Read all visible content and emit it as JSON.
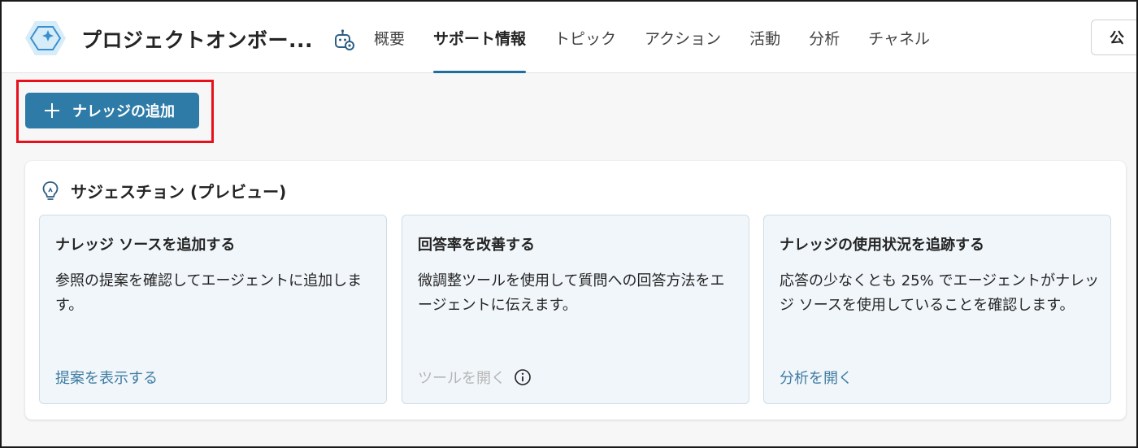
{
  "header": {
    "app_title": "プロジェクトオンボー...",
    "tabs": [
      {
        "label": "概要",
        "active": false
      },
      {
        "label": "サポート情報",
        "active": true
      },
      {
        "label": "トピック",
        "active": false
      },
      {
        "label": "アクション",
        "active": false
      },
      {
        "label": "活動",
        "active": false
      },
      {
        "label": "分析",
        "active": false
      },
      {
        "label": "チャネル",
        "active": false
      }
    ],
    "publish_label": "公"
  },
  "toolbar": {
    "add_knowledge_label": "ナレッジの追加"
  },
  "suggestions": {
    "title": "サジェスチョン (プレビュー)",
    "cards": [
      {
        "title": "ナレッジ ソースを追加する",
        "description": "参照の提案を確認してエージェントに追加します。",
        "link": "提案を表示する",
        "link_enabled": true
      },
      {
        "title": "回答率を改善する",
        "description": "微調整ツールを使用して質問への回答方法をエージェントに伝えます。",
        "link": "ツールを開く",
        "link_enabled": false
      },
      {
        "title": "ナレッジの使用状況を追跡する",
        "description": "応答の少なくとも 25% でエージェントがナレッジ ソースを使用していることを確認します。",
        "link": "分析を開く",
        "link_enabled": true
      }
    ]
  },
  "colors": {
    "accent": "#1f6e9e",
    "button": "#2e7ba8",
    "link": "#3f7ca3",
    "highlight": "#e8101a"
  },
  "icons": {
    "app_logo": "copilot-hexagon-sparkle-icon",
    "agent": "agent-settings-icon",
    "add": "plus-icon",
    "suggestions": "lightbulb-icon",
    "info": "info-icon"
  }
}
